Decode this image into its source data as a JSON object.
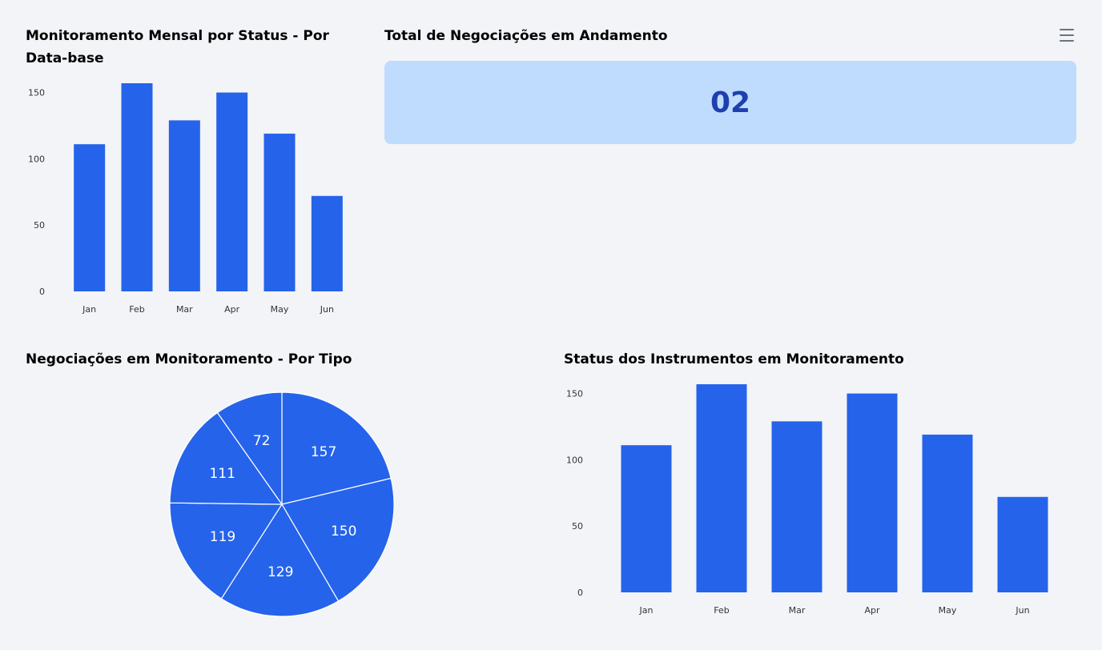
{
  "colors": {
    "background": "#f2f4f7",
    "bar": "#2563eb",
    "kpi_bg": "#bfdbfe",
    "kpi_text": "#1e40af",
    "axis_text": "#333333"
  },
  "cards": {
    "monthly_title": "Monitoramento Mensal por Status - Por Data-base",
    "total_title": "Total de Negociações em Andamento",
    "total_value": "02",
    "type_title": "Negociações em Monitoramento - Por Tipo",
    "status_title": "Status dos Instrumentos em Monitoramento",
    "menu_icon": "hamburger-menu-icon"
  },
  "chart_data": [
    {
      "id": "monthly",
      "type": "bar",
      "title": "Monitoramento Mensal por Status - Por Data-base",
      "categories": [
        "Jan",
        "Feb",
        "Mar",
        "Apr",
        "May",
        "Jun"
      ],
      "values": [
        111,
        157,
        129,
        150,
        119,
        72
      ],
      "yticks": [
        0,
        50,
        100,
        150
      ],
      "ylim": [
        0,
        157
      ],
      "grid": false
    },
    {
      "id": "type",
      "type": "pie",
      "title": "Negociações em Monitoramento - Por Tipo",
      "values": [
        157,
        150,
        129,
        119,
        111,
        72
      ],
      "data_labels": [
        "157",
        "150",
        "129",
        "119",
        "111",
        "72"
      ]
    },
    {
      "id": "status",
      "type": "bar",
      "title": "Status dos Instrumentos em Monitoramento",
      "categories": [
        "Jan",
        "Feb",
        "Mar",
        "Apr",
        "May",
        "Jun"
      ],
      "values": [
        111,
        157,
        129,
        150,
        119,
        72
      ],
      "yticks": [
        0,
        50,
        100,
        150
      ],
      "ylim": [
        0,
        157
      ],
      "grid": false
    }
  ]
}
